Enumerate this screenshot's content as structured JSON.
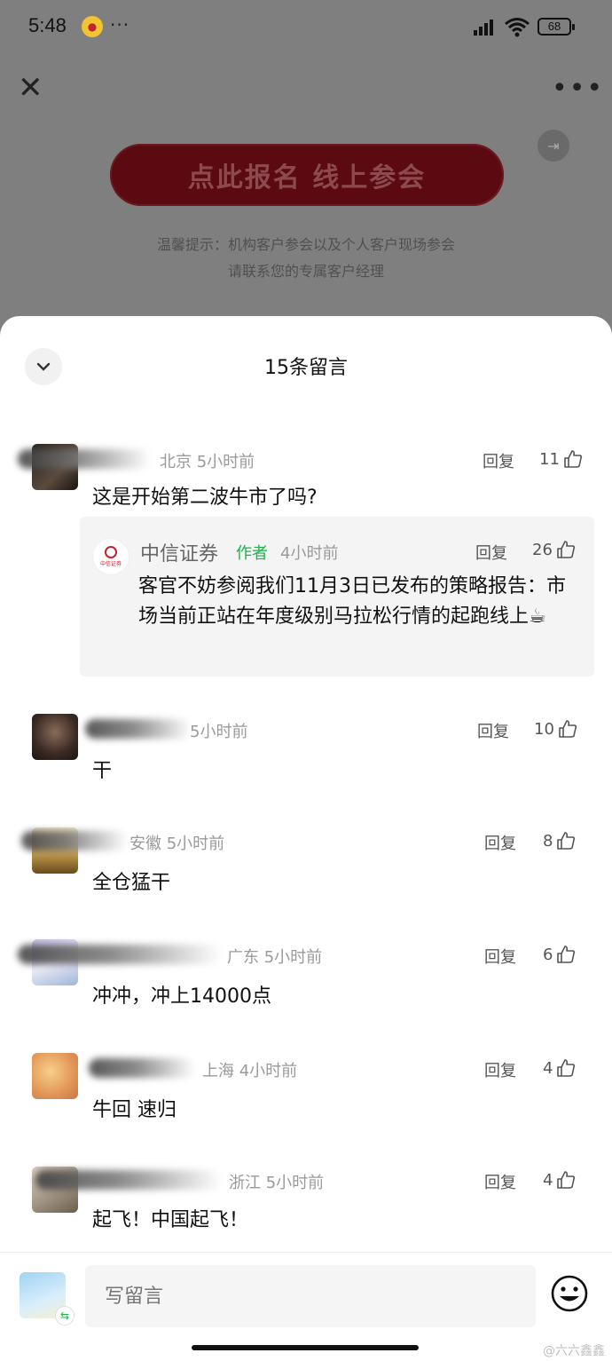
{
  "status_bar": {
    "time": "5:48",
    "battery": "68"
  },
  "background_page": {
    "register_button": "点此报名 线上参会",
    "tip_line1": "温馨提示：机构客户参会以及个人客户现场参会",
    "tip_line2": "请联系您的专属客户经理"
  },
  "sheet": {
    "title": "15条留言"
  },
  "comments": [
    {
      "location_time": "北京 5小时前",
      "reply": "回复",
      "likes": "11",
      "text": "这是开始第二波牛市了吗?"
    },
    {
      "location_time": "5小时前",
      "reply": "回复",
      "likes": "10",
      "text": "干"
    },
    {
      "location_time": "安徽 5小时前",
      "reply": "回复",
      "likes": "8",
      "text": "全仓猛干"
    },
    {
      "location_time": "广东 5小时前",
      "reply": "回复",
      "likes": "6",
      "text": "冲冲，冲上14000点"
    },
    {
      "location_time": "上海 4小时前",
      "reply": "回复",
      "likes": "4",
      "text": "牛回 速归"
    },
    {
      "location_time": "浙江 5小时前",
      "reply": "回复",
      "likes": "4",
      "text": "起飞！中国起飞！"
    }
  ],
  "author_reply": {
    "name": "中信证券",
    "tag": "作者",
    "time": "4小时前",
    "reply": "回复",
    "likes": "26",
    "text": "客官不妨参阅我们11月3日已发布的策略报告：市场当前正站在年度级别马拉松行情的起跑线上☕"
  },
  "composer": {
    "placeholder": "写留言"
  },
  "watermark": "@六六鑫鑫"
}
